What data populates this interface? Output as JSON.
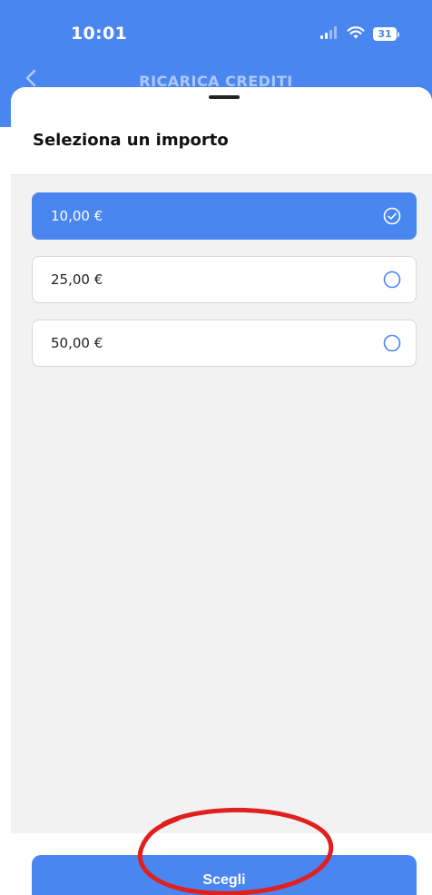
{
  "status_bar": {
    "time": "10:01",
    "battery": "31",
    "icons": [
      "signal-icon",
      "wifi-icon",
      "battery-icon"
    ]
  },
  "header": {
    "back_icon": "chevron-left-icon",
    "title": "RICARICA CREDITI"
  },
  "sheet": {
    "title": "Seleziona un importo"
  },
  "amounts": [
    {
      "label": "10,00 €",
      "selected": true
    },
    {
      "label": "25,00 €",
      "selected": false
    },
    {
      "label": "50,00 €",
      "selected": false
    }
  ],
  "footer": {
    "choose_label": "Scegli"
  },
  "colors": {
    "accent": "#4a86f0",
    "annotation": "#e0201e",
    "sheet_background": "#f2f2f2"
  }
}
